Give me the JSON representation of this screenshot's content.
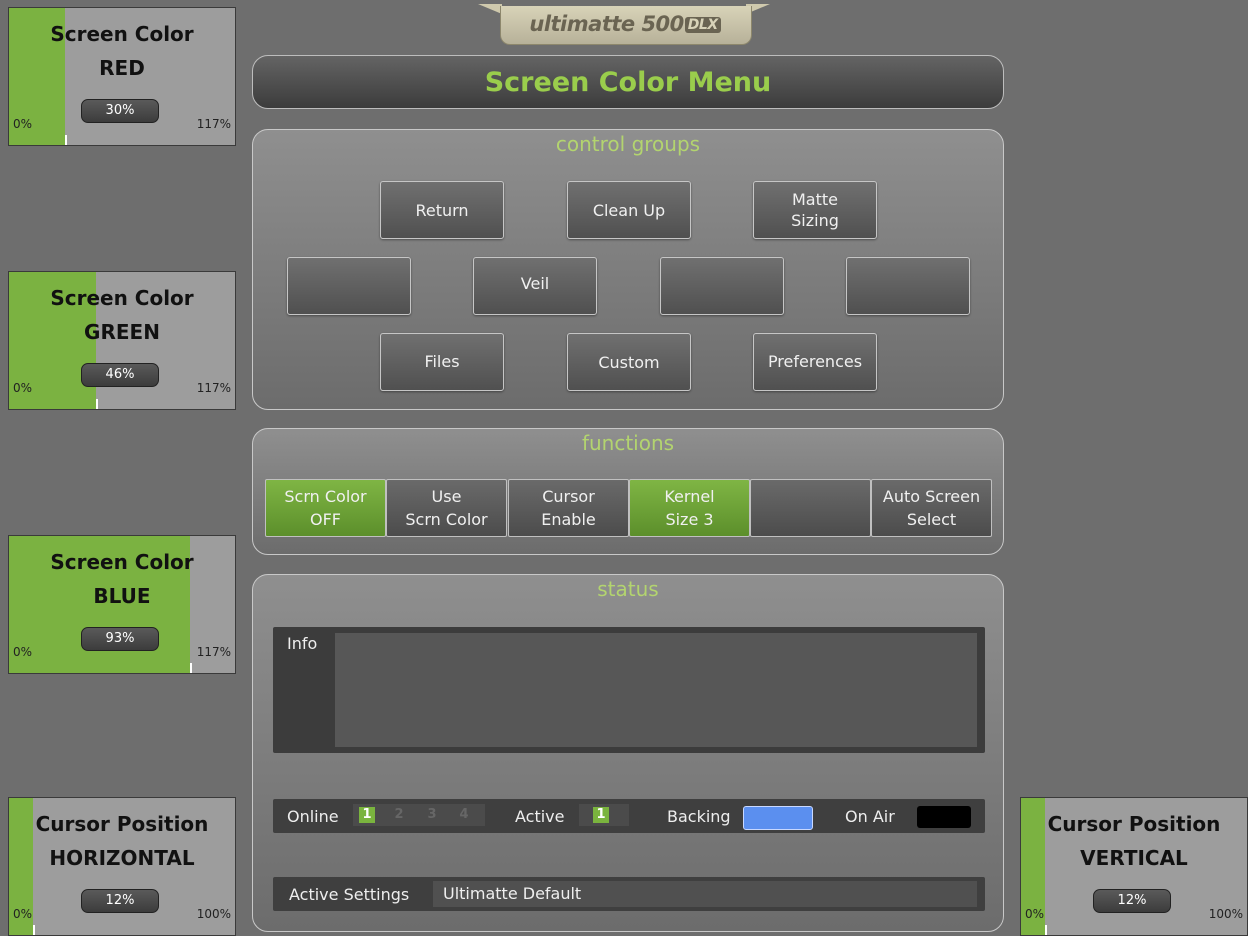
{
  "logo": {
    "text": "ultimatte 500",
    "badge": "DLX"
  },
  "title": "Screen Color Menu",
  "sliders": {
    "red": {
      "line1": "Screen Color",
      "line2": "RED",
      "min": "0%",
      "max": "117%",
      "value": "30%",
      "fraction": 0.256
    },
    "green": {
      "line1": "Screen Color",
      "line2": "GREEN",
      "min": "0%",
      "max": "117%",
      "value": "46%",
      "fraction": 0.393
    },
    "blue": {
      "line1": "Screen Color",
      "line2": "BLUE",
      "min": "0%",
      "max": "117%",
      "value": "93%",
      "fraction": 0.795
    },
    "horizontal": {
      "line1": "Cursor Position",
      "line2": "HORIZONTAL",
      "min": "0%",
      "max": "100%",
      "value": "12%",
      "fraction": 0.12
    },
    "vertical": {
      "line1": "Cursor Position",
      "line2": "VERTICAL",
      "min": "0%",
      "max": "100%",
      "value": "12%",
      "fraction": 0.12
    }
  },
  "control_groups": {
    "title": "control groups",
    "buttons": {
      "return": "Return",
      "clean_up": "Clean Up",
      "matte_sizing": [
        "Matte",
        "Sizing"
      ],
      "blank1": "",
      "veil": "Veil",
      "blank2": "",
      "blank3": "",
      "files": "Files",
      "custom": "Custom",
      "preferences": "Preferences"
    }
  },
  "functions": {
    "title": "functions",
    "buttons": [
      {
        "l1": "Scrn Color",
        "l2": "OFF",
        "active": true
      },
      {
        "l1": "Use",
        "l2": "Scrn Color",
        "active": false
      },
      {
        "l1": "Cursor",
        "l2": "Enable",
        "active": false
      },
      {
        "l1": "Kernel",
        "l2": "Size 3",
        "active": true
      },
      {
        "l1": "",
        "l2": "",
        "active": false
      },
      {
        "l1": "Auto Screen",
        "l2": "Select",
        "active": false
      }
    ]
  },
  "status": {
    "title": "status",
    "info_label": "Info",
    "online_label": "Online",
    "online_numbers": [
      "1",
      "2",
      "3",
      "4"
    ],
    "active_label": "Active",
    "active_number": "1",
    "backing_label": "Backing",
    "backing_color": "#5b8fef",
    "on_air_label": "On Air",
    "on_air_color": "#000000",
    "active_settings_label": "Active Settings",
    "active_settings_value": "Ultimatte Default"
  },
  "colors": {
    "accent_green": "#7bb241",
    "title_green": "#9acd4c",
    "panel_title": "#b3d46f"
  }
}
